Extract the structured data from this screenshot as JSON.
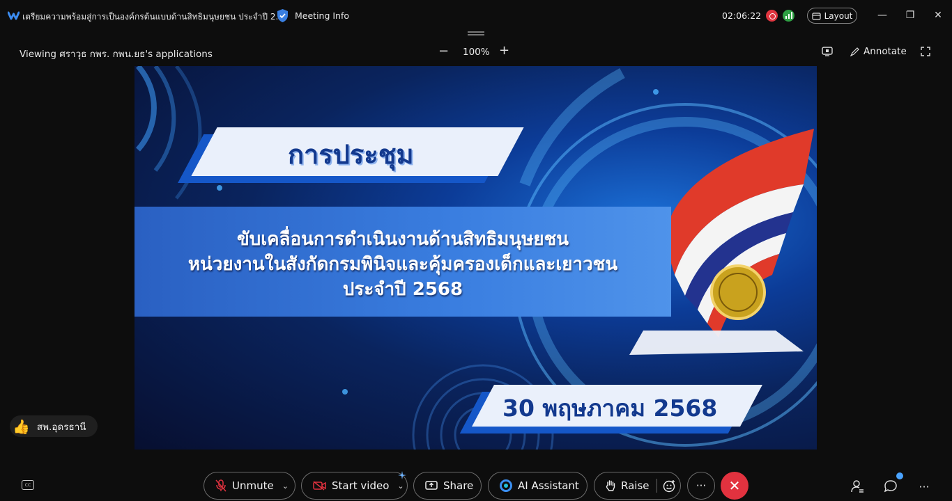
{
  "titlebar": {
    "window_title": "เตรียมความพร้อมสู่การเป็นองค์กรต้นแบบด้านสิทธิมนุษยชน ประจำปี 2...",
    "meeting_info": "Meeting Info",
    "timer": "02:06:22",
    "layout_label": "Layout",
    "minimize_glyph": "—",
    "maximize_glyph": "❐",
    "close_glyph": "✕"
  },
  "share_bar": {
    "viewing_label": "Viewing ศราวุธ กพร. กพน.ยธ's applications",
    "zoom_out_glyph": "−",
    "zoom_level": "100%",
    "zoom_in_glyph": "+",
    "annotate_label": "Annotate"
  },
  "slide": {
    "heading": "การประชุม",
    "line1": "ขับเคลื่อนการดำเนินงานด้านสิทธิมนุษยชน",
    "line2": "หน่วยงานในสังกัดกรมพินิจและคุ้มครองเด็กและเยาวชน",
    "line3": "ประจำปี 2568",
    "date": "30 พฤษภาคม 2568"
  },
  "reaction": {
    "emoji": "👍",
    "name": "สพ.อุดรธานี"
  },
  "toolbar": {
    "cc_label": "CC",
    "unmute": "Unmute",
    "start_video": "Start video",
    "share": "Share",
    "ai_assistant": "AI Assistant",
    "raise": "Raise",
    "more_glyph": "···",
    "end_glyph": "✕",
    "overflow_glyph": "···"
  },
  "colors": {
    "end_call": "#e2323f",
    "recording": "#e0353f",
    "signal": "#2ea043",
    "notification_dot": "#4aa3ff",
    "slide_heading": "#13398e"
  }
}
